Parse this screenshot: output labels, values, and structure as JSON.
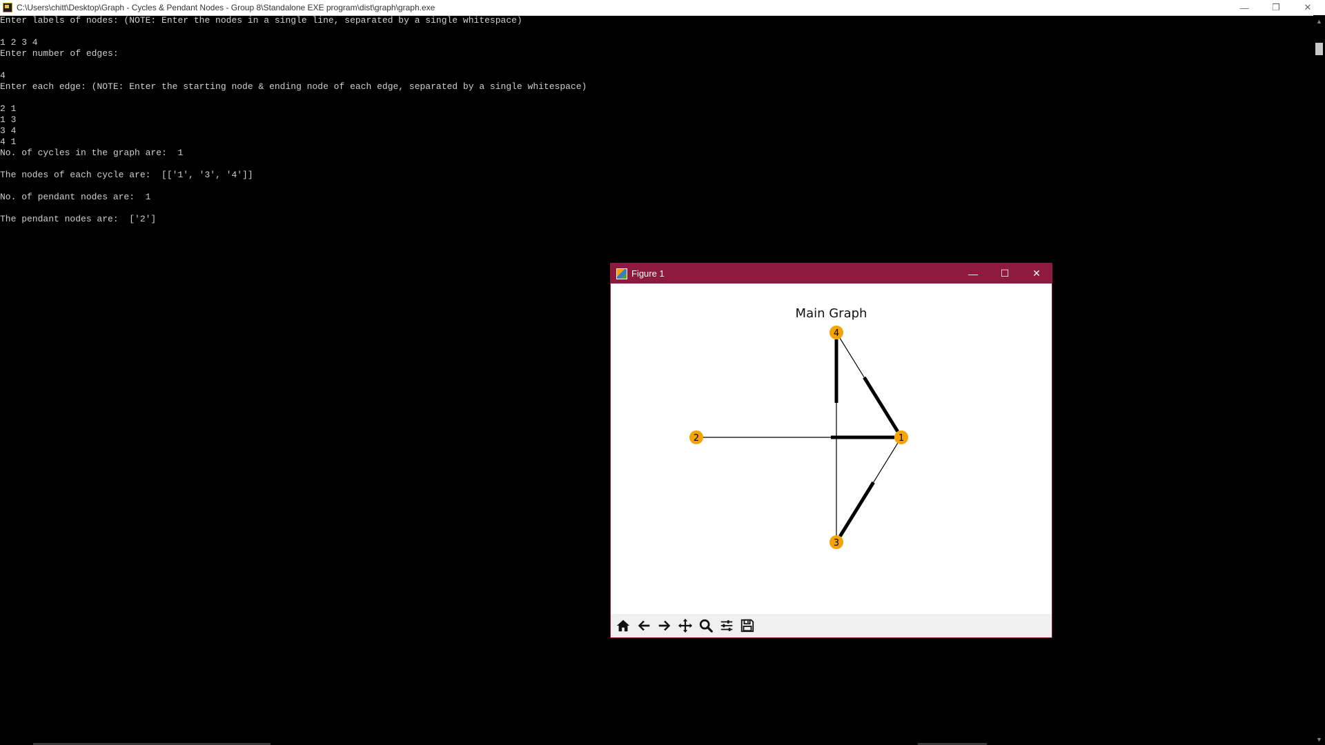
{
  "console": {
    "title": "C:\\Users\\chitt\\Desktop\\Graph - Cycles & Pendant Nodes - Group 8\\Standalone EXE program\\dist\\graph\\graph.exe",
    "lines": [
      "Enter labels of nodes: (NOTE: Enter the nodes in a single line, separated by a single whitespace)",
      "",
      "1 2 3 4",
      "Enter number of edges:",
      "",
      "4",
      "Enter each edge: (NOTE: Enter the starting node & ending node of each edge, separated by a single whitespace)",
      "",
      "2 1",
      "1 3",
      "3 4",
      "4 1",
      "No. of cycles in the graph are:  1",
      "",
      "The nodes of each cycle are:  [['1', '3', '4']]",
      "",
      "No. of pendant nodes are:  1",
      "",
      "The pendant nodes are:  ['2']"
    ],
    "controls": {
      "minimize": "—",
      "restore": "❐",
      "close": "✕"
    }
  },
  "figure": {
    "window_title": "Figure 1",
    "controls": {
      "minimize": "—",
      "maximize": "☐",
      "close": "✕"
    },
    "plot_title": "Main Graph",
    "node_color": "#f5a300",
    "edge_color": "#000000",
    "titlebar_color": "#8e1b3d",
    "nodes": [
      "1",
      "2",
      "3",
      "4"
    ],
    "edges": [
      [
        "2",
        "1"
      ],
      [
        "1",
        "3"
      ],
      [
        "3",
        "4"
      ],
      [
        "4",
        "1"
      ]
    ],
    "toolbar": [
      "home-icon",
      "back-icon",
      "forward-icon",
      "pan-icon",
      "zoom-icon",
      "configure-icon",
      "save-icon"
    ]
  }
}
